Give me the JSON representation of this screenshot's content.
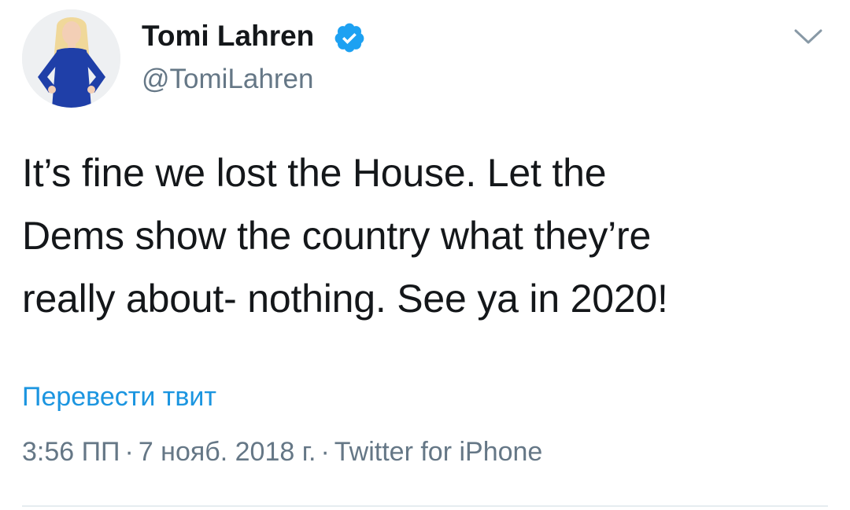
{
  "author": {
    "name": "Tomi Lahren",
    "handle": "@TomiLahren",
    "verified": true
  },
  "tweet": {
    "lines": [
      "It’s fine we lost the House. Let the",
      "Dems show the country what they’re",
      "really about- nothing. See ya in 2020!"
    ]
  },
  "translate_label": "Перевести твит",
  "meta": {
    "time": "3:56 ПП",
    "date": "7 нояб. 2018 г.",
    "source": "Twitter for iPhone",
    "separator": "·"
  },
  "icons": {
    "verified": "verified-badge-icon",
    "menu": "chevron-down-icon"
  },
  "colors": {
    "accent": "#1b95e0",
    "secondary_text": "#657786",
    "primary_text": "#14171a"
  }
}
